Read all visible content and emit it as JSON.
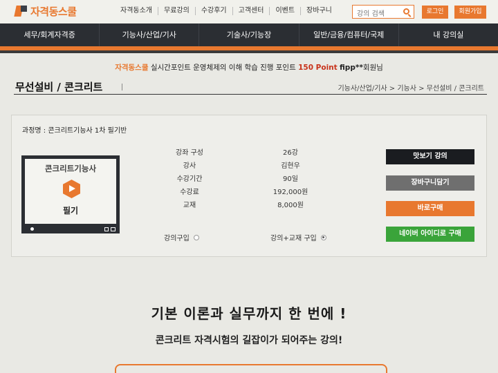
{
  "header": {
    "logo": "자격동스쿨",
    "nav": [
      "자격동소개",
      "무료강의",
      "수강후기",
      "고객센터",
      "이벤트",
      "장바구니"
    ],
    "search_placeholder": "강의 검색",
    "login_label": "로그인",
    "join_label": "회원가입"
  },
  "main_nav": [
    "세무/회계자격증",
    "기능사/산업/기사",
    "기술사/기능장",
    "일반/금융/컴퓨터/국제",
    "내 강의실"
  ],
  "notice": {
    "brand": "자격동스쿨",
    "text": " 실시간포인트 운영체제의 이해 학습 진행 포인트 ",
    "points": "150 Point",
    "user": "fipp**",
    "suffix": "회원님"
  },
  "page": {
    "title": "무선설비 / 콘크리트",
    "breadcrumb": "기능사/산업/기사 > 기능사 > 무선설비 / 콘크리트"
  },
  "product": {
    "course_label": "과정명 : 콘크리트기능사 1차 필기반",
    "thumb_title": "콘크리트기능사",
    "thumb_sub": "필기",
    "details": [
      {
        "label": "강좌 구성",
        "value": "26강"
      },
      {
        "label": "강사",
        "value": "김현우"
      },
      {
        "label": "수강기간",
        "value": "90일"
      },
      {
        "label": "수강료",
        "value": "192,000원"
      },
      {
        "label": "교재",
        "value": "8,000원"
      }
    ],
    "options": [
      {
        "label": "강의구입",
        "selected": false
      },
      {
        "label": "강의+교재 구입",
        "selected": true
      }
    ],
    "buttons": {
      "preview": "맛보기 강의",
      "cart": "장바구니담기",
      "buy": "바로구매",
      "naver": "네이버 아이디로 구매"
    }
  },
  "promo": {
    "headline": "기본 이론과 실무까지 한 번에 !",
    "subline": "콘크리트 자격시험의 길잡이가 되어주는 강의!"
  },
  "colors": {
    "accent": "#e8782f",
    "nav_bg": "#2b2e33",
    "naver_green": "#3aa43a"
  }
}
